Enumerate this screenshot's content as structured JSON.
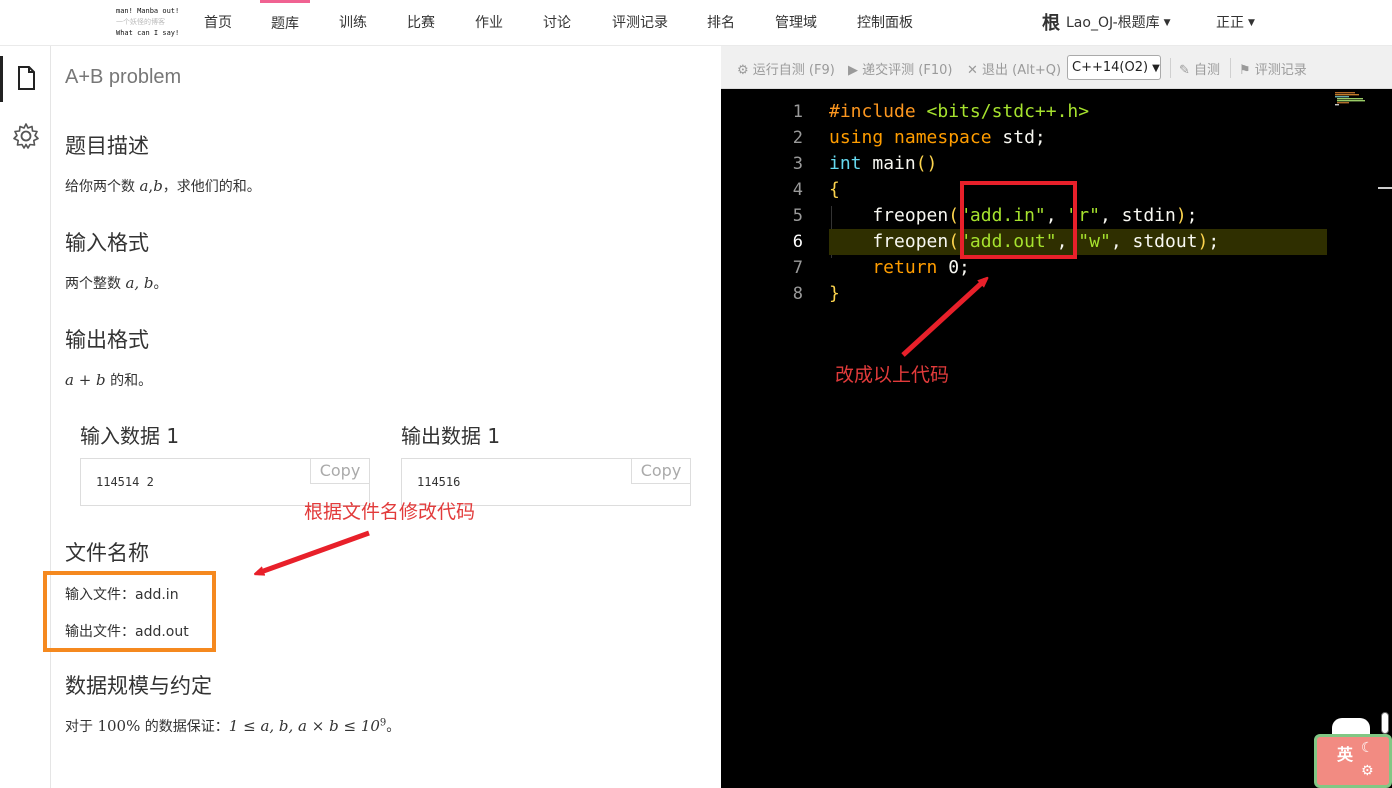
{
  "logo": {
    "line1": "man! Manba out!",
    "line2": "一个妖怪的博客",
    "line3": "What can I say!"
  },
  "nav": {
    "items": [
      "首页",
      "题库",
      "训练",
      "比赛",
      "作业",
      "讨论",
      "评测记录",
      "排名",
      "管理域",
      "控制面板"
    ],
    "active_index": 1,
    "brand_glyph": "根",
    "domain": "Lao_OJ-根题库",
    "user": "正正",
    "accent": "#f06292"
  },
  "problem": {
    "title": "A+B problem",
    "description_heading": "题目描述",
    "description": {
      "prefix": "给你两个数 ",
      "var_a": "a",
      "comma": ",",
      "var_b": "b",
      "suffix": "，求他们的和。"
    },
    "input_heading": "输入格式",
    "input_text": {
      "prefix": "两个整数 ",
      "vars": "a, b",
      "suffix": "。"
    },
    "output_heading": "输出格式",
    "output_text": {
      "expr": "a + b",
      "suffix": " 的和。"
    },
    "samples": [
      {
        "heading": "输入数据 1",
        "value": "114514 2",
        "copy": "Copy"
      },
      {
        "heading": "输出数据 1",
        "value": "114516",
        "copy": "Copy"
      }
    ],
    "file_heading": "文件名称",
    "input_file": "输入文件：add.in",
    "output_file": "输出文件：add.out",
    "limits_heading": "数据规模与约定",
    "limits": {
      "prefix": "对于 ",
      "percent": "100%",
      "mid": " 的数据保证：",
      "expr": "1 ≤ a, b, a × b ≤ 10",
      "exp": "9",
      "suffix": "。"
    }
  },
  "toolbar": {
    "run": "运行自测 (F9)",
    "submit": "递交评测 (F10)",
    "exit": "退出 (Alt+Q)",
    "language": "C++14(O2)",
    "self_test": "自测",
    "records": "评测记录"
  },
  "code": {
    "current_line": 6,
    "lines": [
      {
        "n": "1",
        "parts": [
          [
            "pp",
            "#include "
          ],
          [
            "hdr",
            "<bits/stdc++.h>"
          ]
        ]
      },
      {
        "n": "2",
        "parts": [
          [
            "kw2",
            "using namespace "
          ],
          [
            "fn",
            "std;"
          ]
        ]
      },
      {
        "n": "3",
        "parts": [
          [
            "type",
            "int "
          ],
          [
            "fn",
            "main"
          ],
          [
            "br",
            "()"
          ]
        ]
      },
      {
        "n": "4",
        "parts": [
          [
            "br",
            "{"
          ]
        ]
      },
      {
        "n": "5",
        "parts": [
          [
            "fn",
            "    freopen"
          ],
          [
            "br",
            "("
          ],
          [
            "str",
            "\"add.in\""
          ],
          [
            "fn",
            ", "
          ],
          [
            "str",
            "\"r\""
          ],
          [
            "fn",
            ", stdin"
          ],
          [
            "br",
            ")"
          ],
          [
            "fn",
            ";"
          ]
        ]
      },
      {
        "n": "6",
        "parts": [
          [
            "fn",
            "    freopen"
          ],
          [
            "br",
            "("
          ],
          [
            "str",
            "\"add.out\""
          ],
          [
            "fn",
            ", "
          ],
          [
            "str",
            "\"w\""
          ],
          [
            "fn",
            ", stdout"
          ],
          [
            "br",
            ")"
          ],
          [
            "fn",
            ";"
          ]
        ]
      },
      {
        "n": "7",
        "parts": [
          [
            "kw2",
            "    return "
          ],
          [
            "fn",
            "0;"
          ]
        ]
      },
      {
        "n": "8",
        "parts": [
          [
            "br",
            "}"
          ]
        ]
      }
    ]
  },
  "annotations": {
    "right_note": "改成以上代码",
    "left_note": "根据文件名修改代码",
    "red": "#e8202a",
    "orange": "#f5891f"
  },
  "ime": {
    "label": "英"
  }
}
